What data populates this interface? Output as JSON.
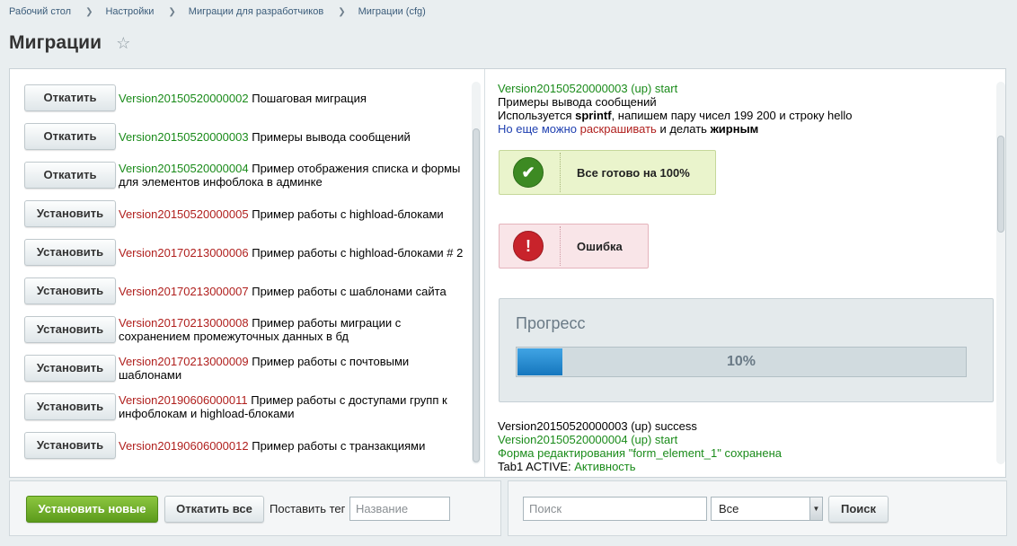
{
  "breadcrumb": [
    "Рабочий стол",
    "Настройки",
    "Миграции для разработчиков",
    "Миграции (cfg)"
  ],
  "page": {
    "title": "Миграции",
    "star_icon": "star-outline-icon"
  },
  "migrations": [
    {
      "action": "Откатить",
      "version": "Version20150520000002",
      "status": "installed",
      "description": "Пошаговая миграция"
    },
    {
      "action": "Откатить",
      "version": "Version20150520000003",
      "status": "installed",
      "description": "Примеры вывода сообщений"
    },
    {
      "action": "Откатить",
      "version": "Version20150520000004",
      "status": "installed",
      "description": "Пример отображения списка и формы для элементов инфоблока в админке"
    },
    {
      "action": "Установить",
      "version": "Version20150520000005",
      "status": "new",
      "description": "Пример работы с highload-блоками"
    },
    {
      "action": "Установить",
      "version": "Version20170213000006",
      "status": "new",
      "description": "Пример работы с highload-блоками # 2"
    },
    {
      "action": "Установить",
      "version": "Version20170213000007",
      "status": "new",
      "description": "Пример работы с шаблонами сайта"
    },
    {
      "action": "Установить",
      "version": "Version20170213000008",
      "status": "new",
      "description": "Пример работы миграции с сохранением промежуточных данных в бд"
    },
    {
      "action": "Установить",
      "version": "Version20170213000009",
      "status": "new",
      "description": "Пример работы с почтовыми шаблонами"
    },
    {
      "action": "Установить",
      "version": "Version20190606000011",
      "status": "new",
      "description": "Пример работы с доступами групп к инфоблокам и highload-блоками"
    },
    {
      "action": "Установить",
      "version": "Version20190606000012",
      "status": "new",
      "description": "Пример работы с транзакциями"
    }
  ],
  "log": {
    "start_line": "Version20150520000003 (up) start",
    "line2": "Примеры вывода сообщений",
    "line3_pre": "Используется ",
    "line3_bold": "sprintf",
    "line3_post": ", напишем пару чисел 199 200 и строку hello",
    "line4_blue": "Но еще можно ",
    "line4_red": "раскрашивать",
    "line4_mid": " и делать ",
    "line4_bold": "жирным",
    "ok_message": "Все готово на 100%",
    "ok_icon": "check-circle-icon",
    "error_message": "Ошибка",
    "error_icon": "exclamation-circle-icon",
    "progress_title": "Прогресс",
    "progress_value": 0.1,
    "progress_text": "10%",
    "after1": "Version20150520000003 (up) success",
    "after2": "Version20150520000004 (up) start",
    "after3": "Форма редактирования \"form_element_1\" сохранена",
    "after4_pre": "Tab1 ACTIVE: ",
    "after4_green": "Активность"
  },
  "footer": {
    "install_new": "Установить новые",
    "rollback_all": "Откатить все",
    "tag_label": "Поставить тег",
    "tag_placeholder": "Название",
    "search_placeholder": "Поиск",
    "filter_value": "Все",
    "search_button": "Поиск"
  },
  "colors": {
    "installed_version": "#1a8b1a",
    "new_version": "#b0201e",
    "accent_green_button": "#6aab26",
    "progress_fill": "#2a8fd3"
  }
}
